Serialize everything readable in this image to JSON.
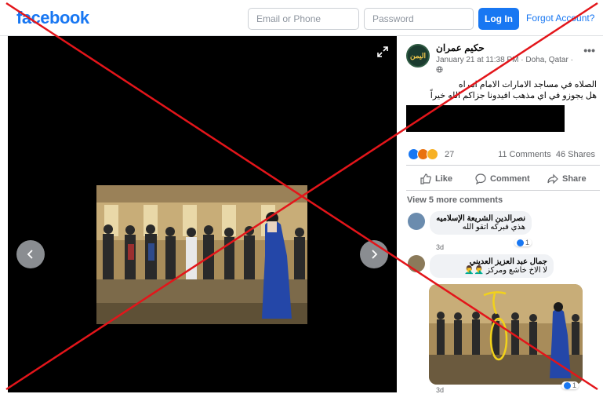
{
  "header": {
    "logo": "facebook",
    "email_placeholder": "Email or Phone",
    "password_placeholder": "Password",
    "login_label": "Log In",
    "forgot_label": "Forgot Account?"
  },
  "post": {
    "author": "حكيم عمران",
    "avatar_text": "اليمن",
    "date": "January 21 at 11:38 PM",
    "separator": "·",
    "location": "Doha, Qatar",
    "caption_line1": "الصلاه في مساجد الامارات الامام امراه",
    "caption_line2": "هل يجوزو في اي مذهب افيدونا جزاكم الله خيراً",
    "reaction_count": "27",
    "comments_count": "11 Comments",
    "shares_count": "46 Shares",
    "actions": {
      "like": "Like",
      "comment": "Comment",
      "share": "Share"
    },
    "view_more": "View 5 more comments"
  },
  "comments": [
    {
      "name": "نصرالدين الشريعة الإسلاميه",
      "text": "هذي فبركه اتقو الله",
      "time": "3d",
      "likes": "1"
    },
    {
      "name": "جمال عبد العزيز العديني",
      "text": "لا الاخ خاشع ومركز 🤦‍♂️🤦‍♂️",
      "time": "3d",
      "likes": "1"
    }
  ],
  "colors": {
    "brand": "#1877f2",
    "cross": "#e3151a",
    "viewer_bg": "#000000"
  },
  "icons": [
    "expand-icon",
    "chevron-left-icon",
    "chevron-right-icon",
    "more-icon",
    "globe-icon",
    "like-icon",
    "comment-icon",
    "share-icon"
  ]
}
